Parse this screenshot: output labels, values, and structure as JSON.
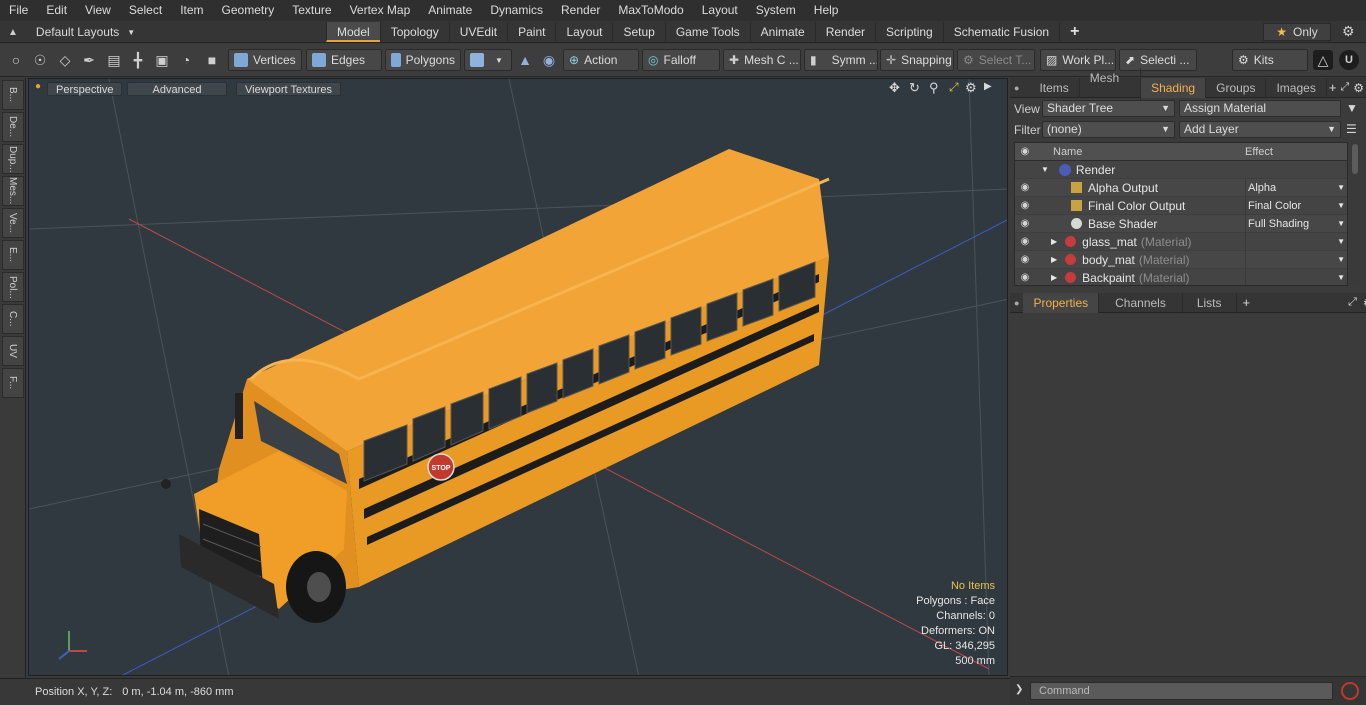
{
  "menubar": [
    "File",
    "Edit",
    "View",
    "Select",
    "Item",
    "Geometry",
    "Texture",
    "Vertex Map",
    "Animate",
    "Dynamics",
    "Render",
    "MaxToModo",
    "Layout",
    "System",
    "Help"
  ],
  "layouts": {
    "label": "Default Layouts"
  },
  "tabs": [
    "Model",
    "Topology",
    "UVEdit",
    "Paint",
    "Layout",
    "Setup",
    "Game Tools",
    "Animate",
    "Render",
    "Scripting",
    "Schematic Fusion"
  ],
  "active_tab": "Model",
  "only_label": "Only",
  "toolbar": {
    "vertices": "Vertices",
    "edges": "Edges",
    "polygons": "Polygons",
    "action": "Action",
    "falloff": "Falloff",
    "mesh": "Mesh C ...",
    "symm": "Symm ...",
    "snapping": "Snapping",
    "select_t": "Select T...",
    "work_pl": "Work Pl...",
    "selecti": "Selecti ...",
    "kits": "Kits"
  },
  "left_strip": [
    "B...",
    "De...",
    "Dup...",
    "Mes...",
    "Ve...",
    "E...",
    "Pol...",
    "C...",
    "UV",
    "F..."
  ],
  "viewport": {
    "perspective": "Perspective",
    "advanced": "Advanced",
    "textures": "Viewport Textures",
    "info": {
      "items": "No Items",
      "polygons": "Polygons : Face",
      "channels": "Channels: 0",
      "deformers": "Deformers: ON",
      "gl": "GL: 346,295",
      "scale": "500 mm"
    },
    "stop_sign": "STOP"
  },
  "status": {
    "label": "Position X, Y, Z:",
    "value": "0 m, -1.04 m, -860 mm"
  },
  "right_panel": {
    "tabs": [
      "Items",
      "Mesh ...",
      "Shading",
      "Groups",
      "Images"
    ],
    "active_tab": "Shading",
    "view_label": "View",
    "view_value": "Shader Tree",
    "assign": "Assign Material",
    "filter_label": "Filter",
    "filter_value": "(none)",
    "add_layer": "Add Layer",
    "tree_headers": {
      "name": "Name",
      "effect": "Effect"
    },
    "tree": [
      {
        "name": "Render",
        "effect": "",
        "kind": "render"
      },
      {
        "name": "Alpha Output",
        "effect": "Alpha",
        "kind": "output"
      },
      {
        "name": "Final Color Output",
        "effect": "Final Color",
        "kind": "output"
      },
      {
        "name": "Base Shader",
        "effect": "Full Shading",
        "kind": "shader"
      },
      {
        "name": "glass_mat",
        "suffix": "(Material)",
        "effect": "",
        "kind": "mat"
      },
      {
        "name": "body_mat",
        "suffix": "(Material)",
        "effect": "",
        "kind": "mat"
      },
      {
        "name": "Backpaint",
        "suffix": "(Material)",
        "effect": "",
        "kind": "mat"
      }
    ],
    "props_tabs": [
      "Properties",
      "Channels",
      "Lists"
    ],
    "props_active": "Properties",
    "command_placeholder": "Command"
  },
  "colors": {
    "accent": "#e8a23a",
    "bus": "#f0a12a",
    "viewport_bg": "#313940"
  }
}
